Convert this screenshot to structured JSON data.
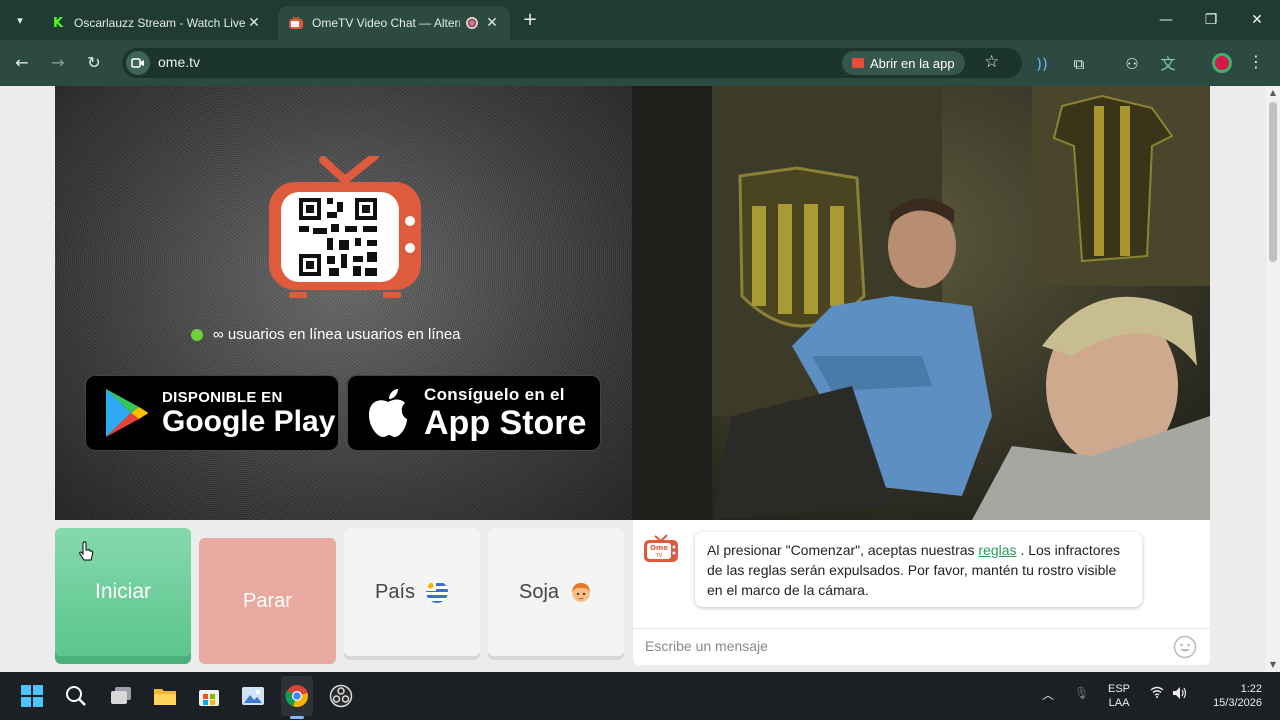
{
  "browser": {
    "tabs": [
      {
        "title": "Oscarlauzz Stream - Watch Live",
        "favicon": "kick-icon",
        "active": false
      },
      {
        "title": "OmeTV Video Chat — Alternati",
        "favicon": "ometv-icon",
        "active": true
      }
    ],
    "url": "ome.tv",
    "open_app_label": "Abrir en la app"
  },
  "page": {
    "online_text": "∞ usuarios en línea usuarios en línea",
    "google_play": {
      "small": "DISPONIBLE EN",
      "big": "Google Play"
    },
    "app_store": {
      "small": "Consíguelo en el",
      "big": "App Store"
    },
    "controls": {
      "start_label": "Iniciar",
      "stop_label": "Parar",
      "country_label": "País",
      "gender_label": "Soja"
    },
    "chat": {
      "logo_line1": "Ome",
      "logo_line2": "TV",
      "message_before": "Al presionar \"Comenzar\", aceptas nuestras",
      "message_link": "reglas",
      "message_after": ". Los infractores de las reglas serán expulsados. Por favor, mantén tu rostro visible en el marco de la cámara.",
      "input_placeholder": "Escribe un mensaje"
    }
  },
  "taskbar": {
    "language_line1": "ESP",
    "language_line2": "LAA",
    "time": "1:22",
    "date": "15/3/2026"
  },
  "colors": {
    "chrome_dark": "#1f3b33",
    "chrome_toolbar": "#2c4a41",
    "start_green": "#5bc58c",
    "stop_red": "#e8a9a0",
    "ometv_red": "#e05a3d",
    "link_green": "#2a9a5c"
  }
}
